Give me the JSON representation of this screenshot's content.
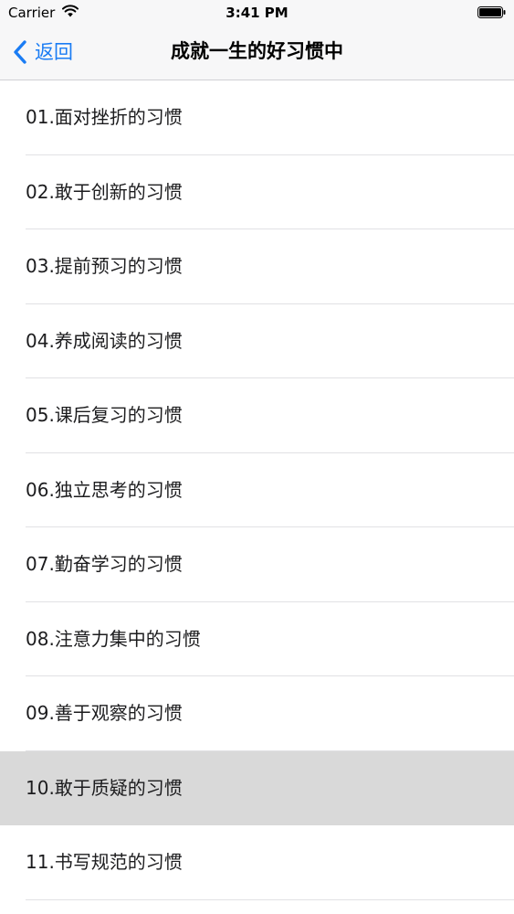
{
  "status_bar": {
    "carrier": "Carrier",
    "time": "3:41 PM",
    "icons": [
      "wifi-icon",
      "battery-icon"
    ]
  },
  "nav": {
    "back_label": "返回",
    "back_icon": "chevron-left-icon",
    "title": "成就一生的好习惯中",
    "accent_color": "#1a7cf4"
  },
  "list": {
    "selected_index": 9,
    "selected_color": "#d9d9d9",
    "items": [
      {
        "label": "01.面对挫折的习惯"
      },
      {
        "label": "02.敢于创新的习惯"
      },
      {
        "label": "03.提前预习的习惯"
      },
      {
        "label": "04.养成阅读的习惯"
      },
      {
        "label": "05.课后复习的习惯"
      },
      {
        "label": "06.独立思考的习惯"
      },
      {
        "label": "07.勤奋学习的习惯"
      },
      {
        "label": "08.注意力集中的习惯"
      },
      {
        "label": "09.善于观察的习惯"
      },
      {
        "label": "10.敢于质疑的习惯"
      },
      {
        "label": "11.书写规范的习惯"
      }
    ]
  }
}
